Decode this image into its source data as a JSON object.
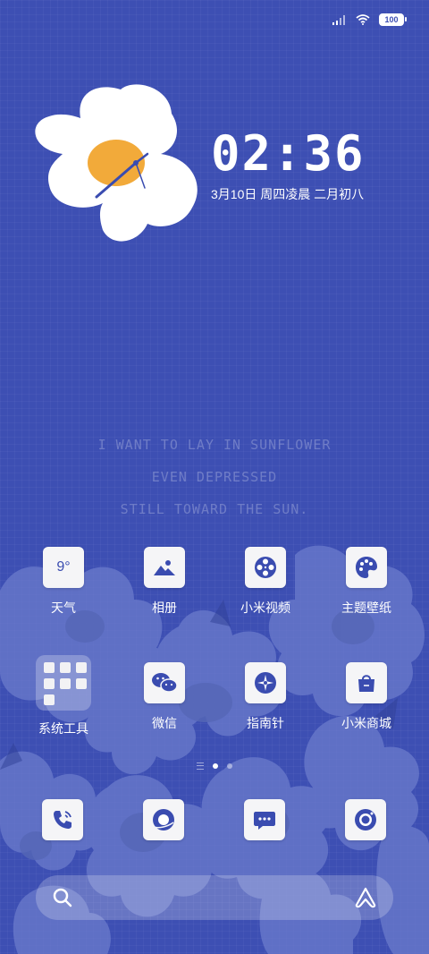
{
  "status_bar": {
    "battery": "100",
    "signal_icon": "signal-icon",
    "wifi_icon": "wifi-icon"
  },
  "clock": {
    "time": "02:36",
    "date": "3月10日 周四凌晨 二月初八"
  },
  "quote": {
    "lines": [
      "I WANT TO LAY IN SUNFLOWER",
      "EVEN DEPRESSED",
      "STILL TOWARD THE SUN."
    ]
  },
  "apps": [
    {
      "label": "天气",
      "icon": "weather-icon",
      "text": "9°"
    },
    {
      "label": "相册",
      "icon": "gallery-icon"
    },
    {
      "label": "小米视频",
      "icon": "video-icon"
    },
    {
      "label": "主题壁纸",
      "icon": "theme-icon"
    },
    {
      "label": "系统工具",
      "icon": "folder-icon"
    },
    {
      "label": "微信",
      "icon": "wechat-icon"
    },
    {
      "label": "指南针",
      "icon": "compass-icon"
    },
    {
      "label": "小米商城",
      "icon": "shop-icon"
    }
  ],
  "dock": [
    {
      "icon": "phone-icon"
    },
    {
      "icon": "browser-icon"
    },
    {
      "icon": "messages-icon"
    },
    {
      "icon": "camera-icon"
    }
  ],
  "colors": {
    "background": "#3d4fb3",
    "icon_blue": "#3a4cb0",
    "accent_orange": "#f2aa3a"
  }
}
